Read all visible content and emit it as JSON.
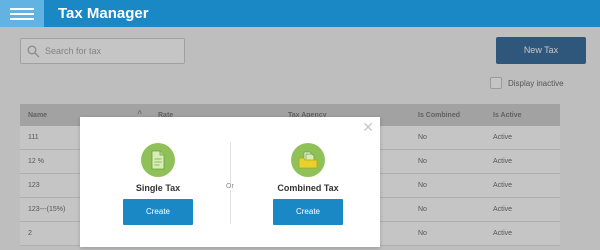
{
  "header": {
    "title": "Tax Manager",
    "menu_icon": "hamburger-menu-icon",
    "color": "#1b88c6"
  },
  "search": {
    "placeholder": "Search for tax",
    "icon": "search-icon"
  },
  "new_tax_label": "New Tax",
  "display_inactive": {
    "label": "Display inactive",
    "checked": false
  },
  "table": {
    "columns": [
      "Name",
      "Rate",
      "Tax Agency",
      "Is Combined",
      "Is Active"
    ],
    "rows": [
      {
        "name": "111",
        "combined": "No",
        "active": "Active"
      },
      {
        "name": "12 %",
        "combined": "No",
        "active": "Active"
      },
      {
        "name": "123",
        "combined": "No",
        "active": "Active"
      },
      {
        "name": "123---(15%)",
        "combined": "No",
        "active": "Active"
      },
      {
        "name": "2",
        "combined": "No",
        "active": "Active"
      }
    ]
  },
  "modal": {
    "close_icon": "close-icon",
    "single": {
      "title": "Single Tax",
      "button": "Create",
      "icon": "document-icon"
    },
    "or_label": "Or",
    "combined": {
      "title": "Combined Tax",
      "button": "Create",
      "icon": "folder-documents-icon"
    }
  }
}
